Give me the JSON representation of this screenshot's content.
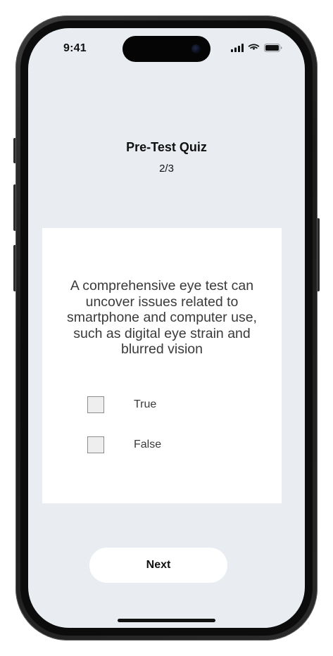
{
  "status_bar": {
    "time": "9:41",
    "signal_icon": "cellular-signal-icon",
    "wifi_icon": "wifi-icon",
    "battery_icon": "battery-icon"
  },
  "quiz": {
    "title": "Pre-Test Quiz",
    "progress": "2/3",
    "question": "A comprehensive eye test can uncover issues related to smartphone and computer use, such as digital eye strain and blurred vision",
    "options": [
      {
        "label": "True",
        "checked": false
      },
      {
        "label": "False",
        "checked": false
      }
    ],
    "next_label": "Next"
  },
  "colors": {
    "screen_background": "#e9edf2",
    "card_background": "#ffffff",
    "text_primary": "#111111",
    "text_secondary": "#3a3a3a"
  }
}
